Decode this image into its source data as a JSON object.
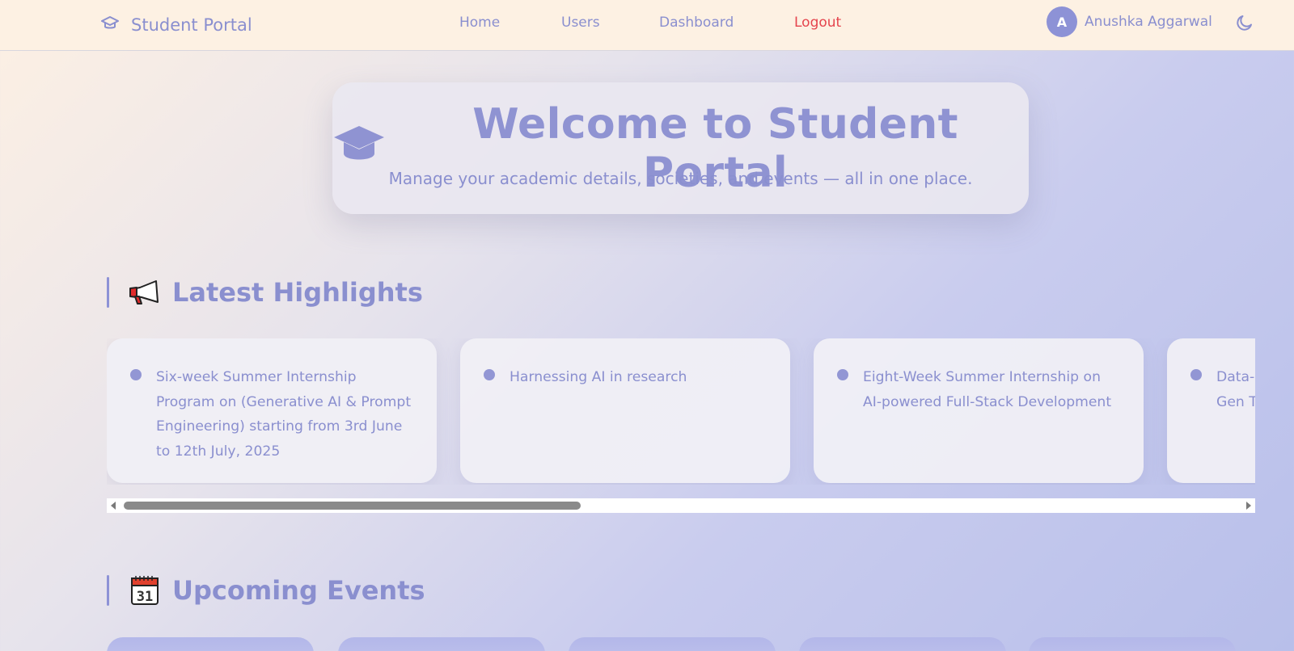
{
  "navbar": {
    "brand": "Student Portal",
    "links": [
      "Home",
      "Users",
      "Dashboard",
      "Logout"
    ],
    "user": {
      "initial": "A",
      "name": "Anushka Aggarwal"
    },
    "icons": {
      "brand": "graduation-cap-icon",
      "theme": "moon-icon"
    }
  },
  "hero": {
    "title": "Welcome to Student Portal",
    "subtitle": "Manage your academic details, societies, and events — all in one place."
  },
  "highlights": {
    "heading": "Latest Highlights",
    "icon": "megaphone-icon",
    "items": [
      "Six-week Summer Internship Program on (Generative AI & Prompt Engineering) starting from 3rd June to 12th July, 2025",
      "Harnessing AI in research",
      "Eight-Week Summer Internship on AI-powered Full-Stack Development",
      "Data-Driven Innovations for Next-Gen Tech"
    ]
  },
  "events": {
    "heading": "Upcoming Events",
    "icon": "calendar-icon"
  },
  "colors": {
    "accent": "#8a8fcf",
    "logout": "#e5444d",
    "nav_bg": "#fdf1e3"
  }
}
